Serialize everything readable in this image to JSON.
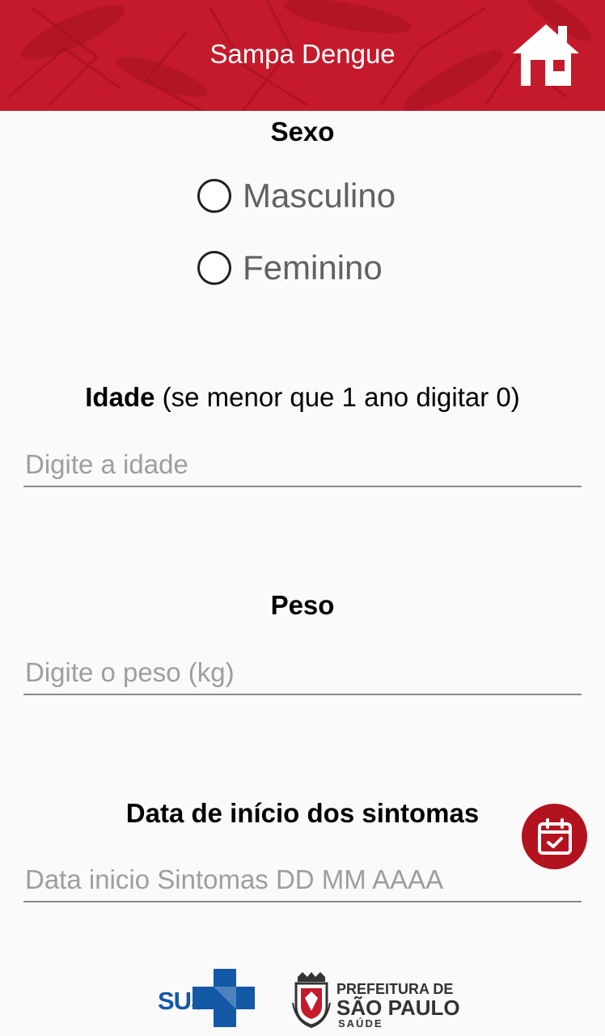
{
  "app_bar": {
    "title": "Sampa Dengue",
    "home_icon": "home-icon",
    "color": "#c41a2b"
  },
  "sexo": {
    "label": "Sexo",
    "options": [
      {
        "label": "Masculino",
        "selected": false
      },
      {
        "label": "Feminino",
        "selected": false
      }
    ]
  },
  "idade": {
    "label_bold": "Idade",
    "label_rest": " (se menor que 1 ano digitar 0)",
    "placeholder": "Digite a idade",
    "value": ""
  },
  "peso": {
    "label": "Peso",
    "placeholder": "Digite o peso (kg)",
    "value": ""
  },
  "data_inicio": {
    "label": "Data de início dos sintomas",
    "placeholder": "Data inicio Sintomas DD MM AAAA",
    "value": "",
    "calendar_icon": "calendar-icon",
    "button_color": "#b3121f"
  },
  "footer": {
    "sus_text": "SUS",
    "prefeitura_line1": "PREFEITURA DE",
    "prefeitura_line2": "SÃO PAULO",
    "prefeitura_line3": "SAÚDE"
  }
}
